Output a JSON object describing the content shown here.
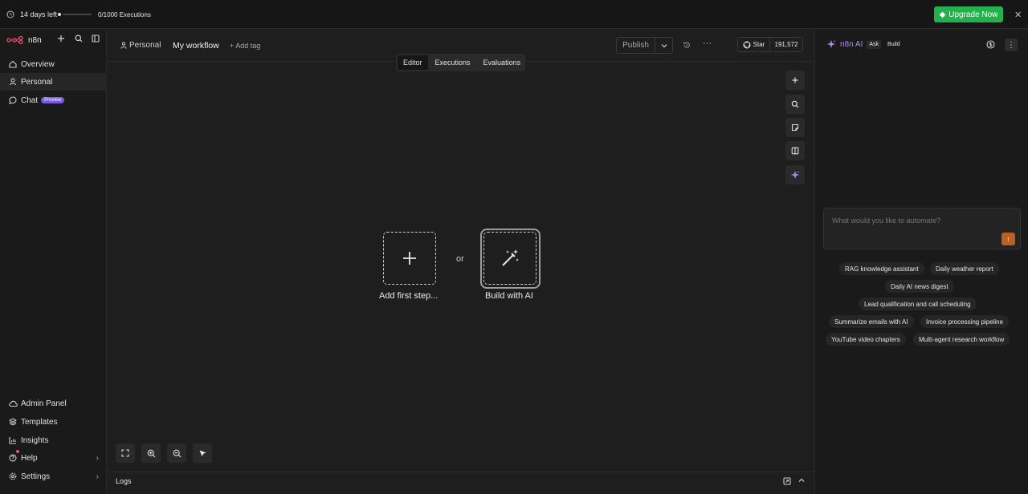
{
  "trial": {
    "days_left": "14 days left",
    "executions": "0/1000 Executions",
    "upgrade_label": "Upgrade Now"
  },
  "sidebar": {
    "brand": "n8n",
    "top_items": [
      {
        "label": "Overview",
        "icon": "home-icon"
      },
      {
        "label": "Personal",
        "icon": "user-icon"
      },
      {
        "label": "Chat",
        "icon": "chat-icon",
        "badge": "Preview"
      }
    ],
    "bottom_items": [
      {
        "label": "Admin Panel",
        "icon": "cloud-icon"
      },
      {
        "label": "Templates",
        "icon": "templates-icon"
      },
      {
        "label": "Insights",
        "icon": "insights-icon"
      },
      {
        "label": "Help",
        "icon": "help-icon"
      },
      {
        "label": "Settings",
        "icon": "settings-icon"
      }
    ]
  },
  "header": {
    "project": "Personal",
    "workflow_name": "My workflow",
    "add_tag": "+ Add tag",
    "publish": "Publish",
    "github_star": "Star",
    "github_count": "191,572"
  },
  "tabs": [
    "Editor",
    "Executions",
    "Evaluations"
  ],
  "canvas": {
    "add_first_step": "Add first step...",
    "or": "or",
    "build_with_ai": "Build with AI"
  },
  "logs": {
    "label": "Logs"
  },
  "ai_panel": {
    "title": "n8n AI",
    "mode_ask": "Ask",
    "mode_build": "Build",
    "placeholder": "What would you like to automate?",
    "suggestions": [
      "RAG knowledge assistant",
      "Daily weather report",
      "Daily AI news digest",
      "Lead qualification and call scheduling",
      "Summarize emails with AI",
      "Invoice processing pipeline",
      "YouTube video chapters",
      "Multi-agent research workflow"
    ]
  },
  "colors": {
    "upgrade": "#22b14c",
    "accent_ai": "#a98cf0",
    "send_button": "#b96024",
    "brand_logo": "#ea4b71"
  }
}
